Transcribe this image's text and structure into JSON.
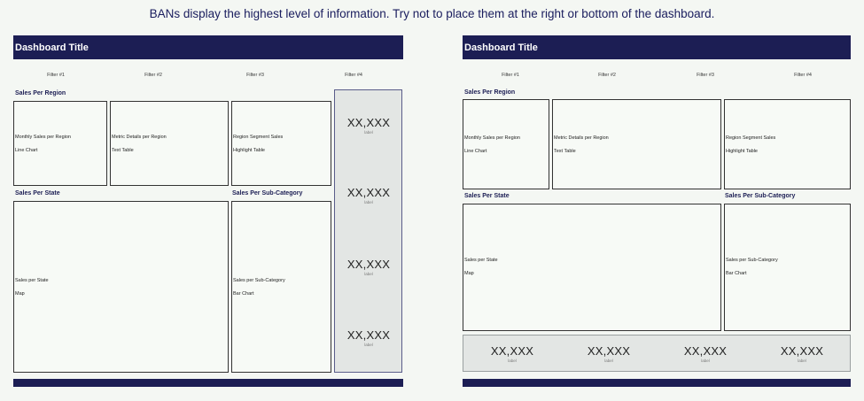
{
  "caption": "BANs display the highest level of information. Try not to place them at the right or bottom of the dashboard.",
  "left": {
    "title": "Dashboard Title",
    "filters": [
      "Filter #1",
      "Filter #2",
      "Filter #3",
      "Filter #4"
    ],
    "sec_region": "Sales Per Region",
    "sec_state": "Sales Per State",
    "sec_subcat": "Sales Per Sub-Category",
    "boxes": {
      "monthly": [
        "Monthly Sales per Region",
        "Line Chart"
      ],
      "metric": [
        "Metric Details per Region",
        "Text Table"
      ],
      "segment": [
        "Region Segment Sales",
        "Highlight Table"
      ],
      "state": [
        "Sales per State",
        "Map"
      ],
      "subcat": [
        "Sales per Sub-Category",
        "Bar Chart"
      ]
    },
    "bans": [
      {
        "value": "XX,XXX",
        "label": "label"
      },
      {
        "value": "XX,XXX",
        "label": "label"
      },
      {
        "value": "XX,XXX",
        "label": "label"
      },
      {
        "value": "XX,XXX",
        "label": "label"
      }
    ]
  },
  "right": {
    "title": "Dashboard Title",
    "filters": [
      "Filter #1",
      "Filter #2",
      "Filter #3",
      "Filter #4"
    ],
    "sec_region": "Sales Per Region",
    "sec_state": "Sales Per State",
    "sec_subcat": "Sales Per Sub-Category",
    "boxes": {
      "monthly": [
        "Monthly Sales per Region",
        "Line Chart"
      ],
      "metric": [
        "Metric Details per Region",
        "Text Table"
      ],
      "segment": [
        "Region Segment Sales",
        "Highlight Table"
      ],
      "state": [
        "Sales per State",
        "Map"
      ],
      "subcat": [
        "Sales per Sub-Category",
        "Bar Chart"
      ]
    },
    "bans": [
      {
        "value": "XX,XXX",
        "label": "label"
      },
      {
        "value": "XX,XXX",
        "label": "label"
      },
      {
        "value": "XX,XXX",
        "label": "label"
      },
      {
        "value": "XX,XXX",
        "label": "label"
      }
    ]
  },
  "colors": {
    "header": "#1c1e54",
    "background": "#f4f7f3",
    "ban_panel": "#e3e6e4"
  }
}
